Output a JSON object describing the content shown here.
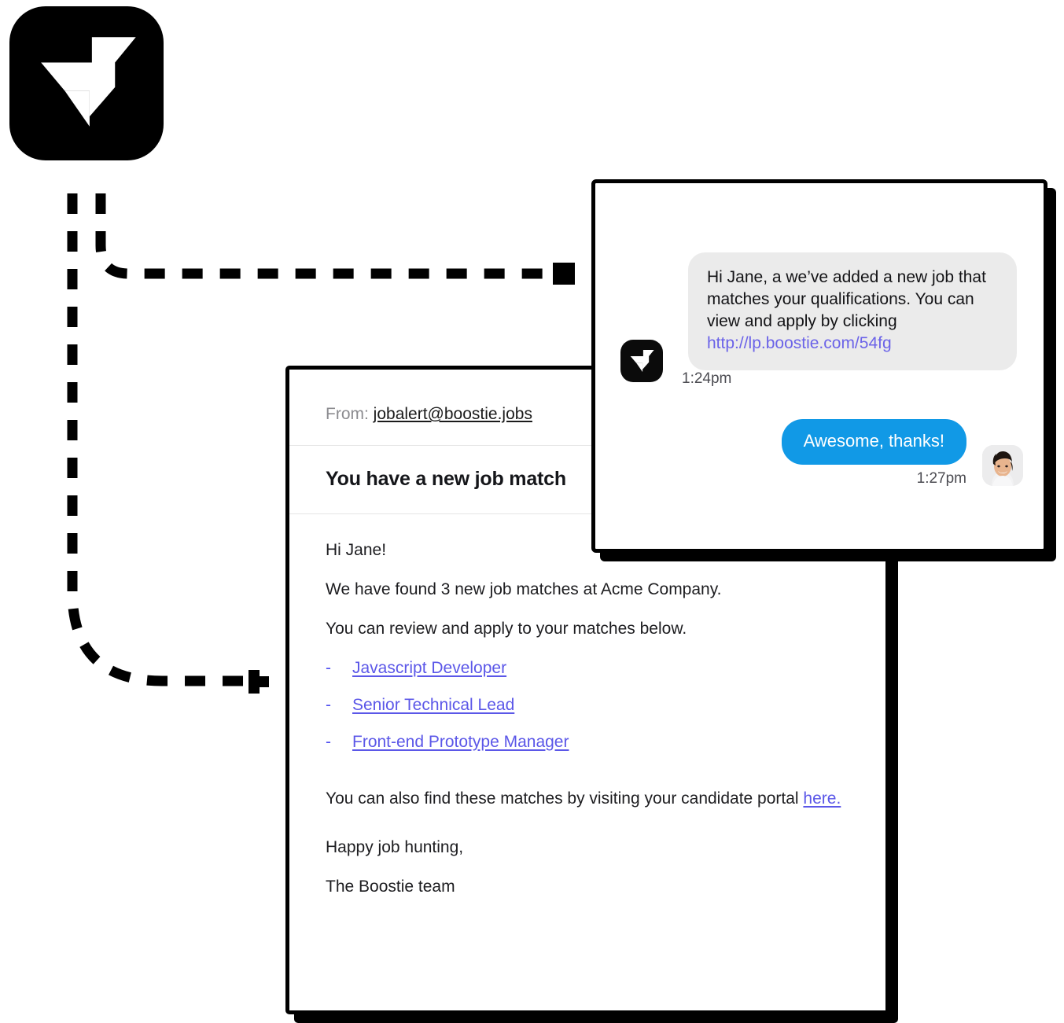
{
  "brand": {
    "logo_icon": "boostie-lightning-bird-logo",
    "accent_blue": "#1199e6",
    "link_purple": "#5b57e8",
    "bubble_grey": "#ebebeb"
  },
  "connectors": {
    "style": "dashed",
    "color": "#000000",
    "description": "dashed flow lines from brand logo to sms card and to email card"
  },
  "sms_card": {
    "name": "sms-conversation-card",
    "sender_icon": "boostie-lightning-bird-logo",
    "messages": [
      {
        "direction": "incoming",
        "text_before_link": "Hi Jane, a we’ve added a new job that matches your qualifications. You can view and apply by clicking ",
        "link": "http://lp.boostie.com/54fg",
        "timestamp": "1:24pm"
      },
      {
        "direction": "outgoing",
        "text": "Awesome, thanks!",
        "timestamp": "1:27pm",
        "avatar": "jane-profile-photo"
      }
    ]
  },
  "email_card": {
    "name": "email-preview-card",
    "from_label": "From:",
    "from_address": "jobalert@boostie.jobs",
    "subject": "You have a new job match",
    "greeting": "Hi Jane!",
    "intro": "We have found 3 new job matches at Acme Company.",
    "instruction": "You can review and apply to your matches below.",
    "list_bullet": "-",
    "job_matches": [
      "Javascript Developer",
      "Senior Technical Lead",
      "Front-end Prototype Manager"
    ],
    "portal_text_before": "You can also find these matches by visiting your candidate portal ",
    "portal_link": "here.",
    "signoff": "Happy job hunting,",
    "team": "The Boostie team"
  }
}
